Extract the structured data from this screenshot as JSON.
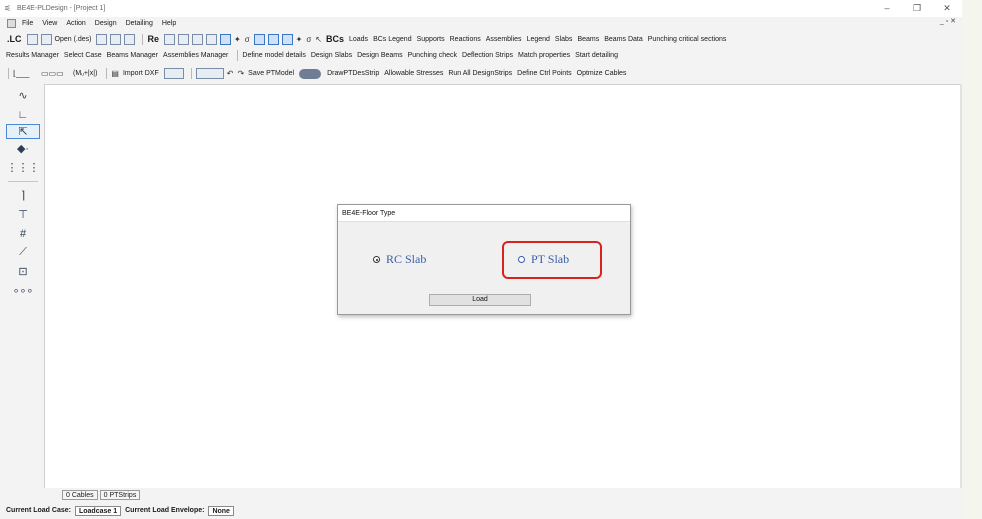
{
  "window": {
    "title": "BE4E-PLDesign - [Project 1]",
    "controls": [
      "–",
      "❐",
      "✕"
    ],
    "mdi_controls": "_ ▫ ✕"
  },
  "menu": [
    "File",
    "View",
    "Action",
    "Design",
    "Detailing",
    "Help"
  ],
  "toolbar1": {
    "lc": ".LC",
    "open": "Open (.des)",
    "re": "Re",
    "bcs": "BCs",
    "items": [
      "Loads",
      "BCs Legend",
      "Supports",
      "Reactions",
      "Assemblies",
      "Legend",
      "Slabs",
      "Beams",
      "Beams Data",
      "Punching critical sections"
    ]
  },
  "toolbar2": {
    "items": [
      "Results Manager",
      "Select Case",
      "Beams Manager",
      "Assemblies Manager"
    ],
    "items2": [
      "Define model details",
      "Design Slabs",
      "Design Beams",
      "Punching check",
      "Deflection Strips",
      "Match properties",
      "Start detailing"
    ]
  },
  "toolbar3": {
    "moment": "(Mᵤ+|x|)",
    "import": "Import DXF",
    "save": "Save PTModel",
    "items": [
      "DrawPTDesStrip",
      "Allowable Stresses",
      "Run All DesignStrips",
      "Define Ctrl Points",
      "Optmize Cables"
    ]
  },
  "dialog": {
    "title": "BE4E-Floor Type",
    "options": [
      {
        "label": "RC Slab",
        "selected": true
      },
      {
        "label": "PT Slab",
        "selected": false
      }
    ],
    "button": "Load",
    "highlight_color": "#d9221e"
  },
  "bottom_tabs": [
    "0 Cables",
    "0 PTStrips"
  ],
  "status": {
    "load_case_label": "Current Load Case:",
    "load_case_value": "Loadcase 1",
    "envelope_label": "Current Load Envelope:",
    "envelope_value": "None"
  }
}
